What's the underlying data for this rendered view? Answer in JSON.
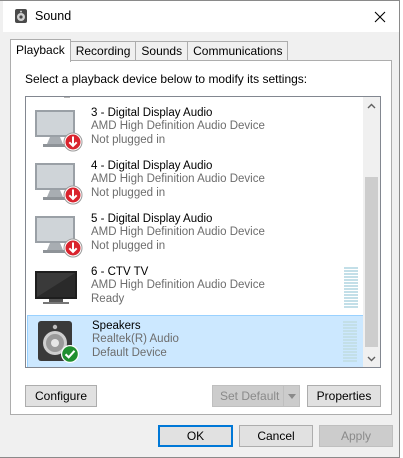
{
  "window": {
    "title": "Sound"
  },
  "tabs": [
    {
      "label": "Playback",
      "active": true
    },
    {
      "label": "Recording",
      "active": false
    },
    {
      "label": "Sounds",
      "active": false
    },
    {
      "label": "Communications",
      "active": false
    }
  ],
  "playback": {
    "instruction": "Select a playback device below to modify its settings:",
    "devices": [
      {
        "name": "3 - Digital Display Audio",
        "driver": "AMD High Definition Audio Device",
        "status": "Not plugged in",
        "icon": "monitor-icon",
        "badge": "down-arrow-badge-icon"
      },
      {
        "name": "4 - Digital Display Audio",
        "driver": "AMD High Definition Audio Device",
        "status": "Not plugged in",
        "icon": "monitor-icon",
        "badge": "down-arrow-badge-icon"
      },
      {
        "name": "5 - Digital Display Audio",
        "driver": "AMD High Definition Audio Device",
        "status": "Not plugged in",
        "icon": "monitor-icon",
        "badge": "down-arrow-badge-icon"
      },
      {
        "name": "6 - CTV TV",
        "driver": "AMD High Definition Audio Device",
        "status": "Ready",
        "icon": "tv-icon"
      },
      {
        "name": "Speakers",
        "driver": "Realtek(R) Audio",
        "status": "Default Device",
        "icon": "speaker-icon",
        "badge": "checkmark-badge-icon",
        "selected": true
      }
    ],
    "buttons": {
      "configure": "Configure",
      "set_default": "Set Default",
      "properties": "Properties"
    }
  },
  "footer": {
    "ok": "OK",
    "cancel": "Cancel",
    "apply": "Apply"
  },
  "colors": {
    "selection": "#cce8ff",
    "badge_red": "#d9232d",
    "badge_green": "#1f8f2f",
    "focus": "#0078d7"
  }
}
